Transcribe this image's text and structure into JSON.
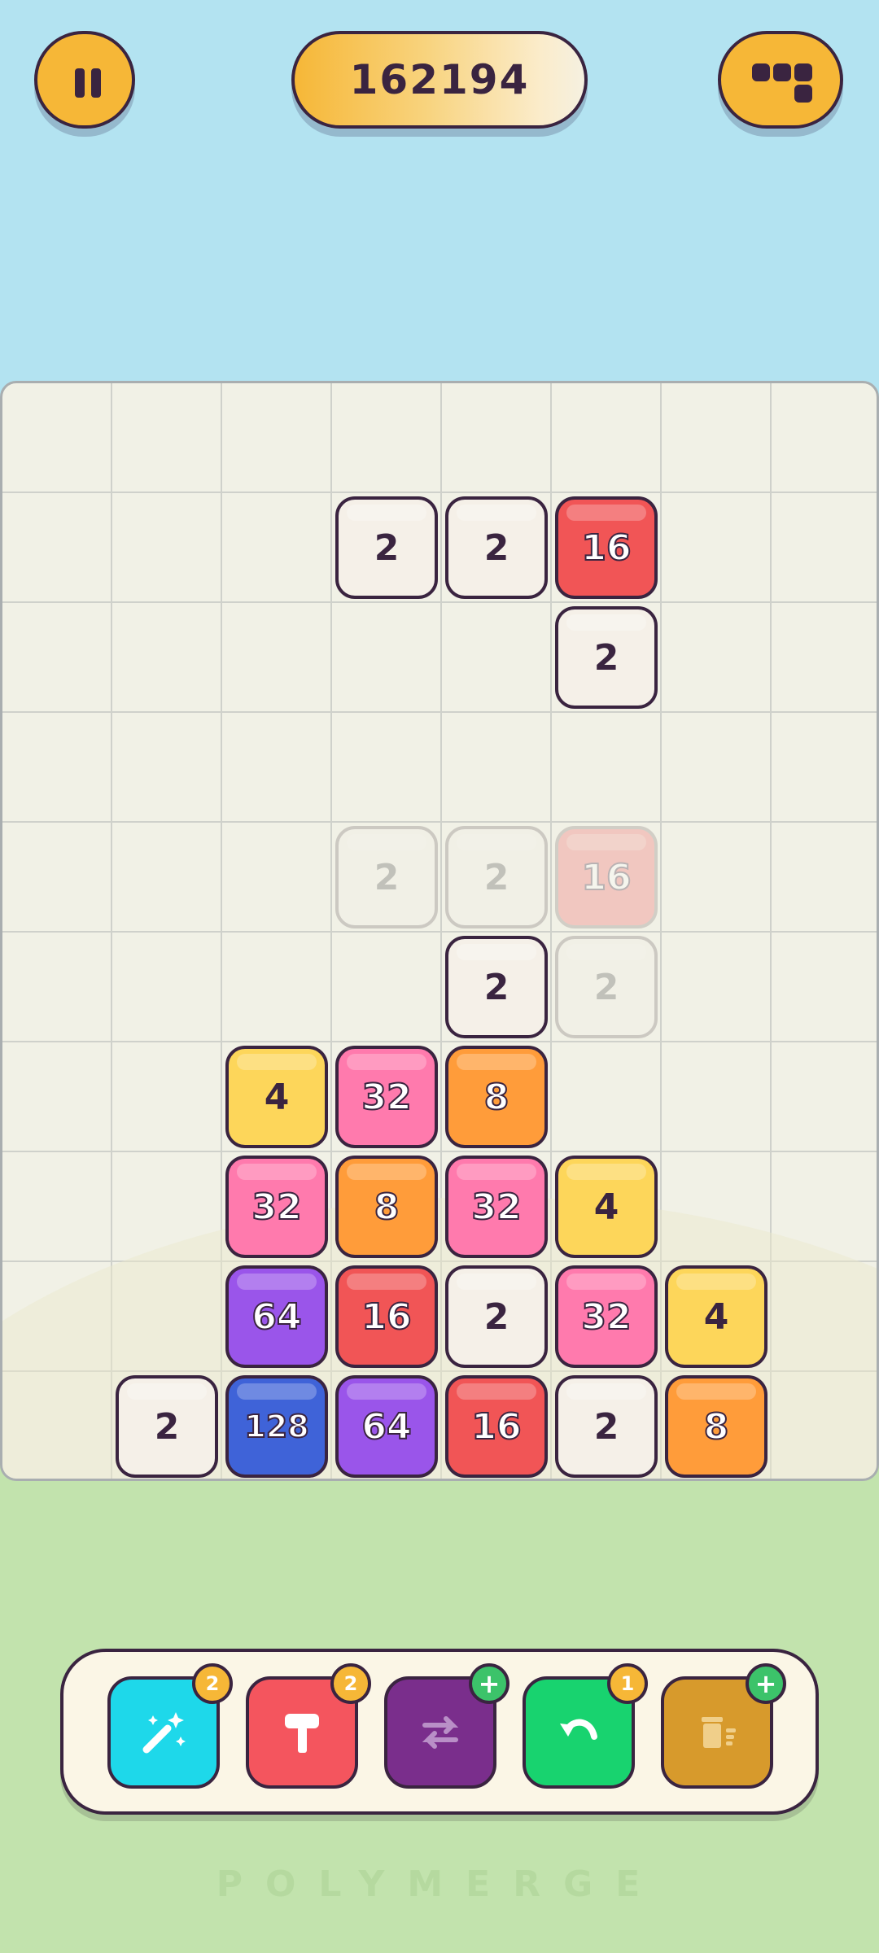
{
  "score": "162194",
  "board": {
    "columns": 8,
    "rows": 10,
    "tiles": [
      {
        "row": 1,
        "col": 3,
        "value": "2"
      },
      {
        "row": 1,
        "col": 4,
        "value": "2"
      },
      {
        "row": 1,
        "col": 5,
        "value": "16"
      },
      {
        "row": 2,
        "col": 5,
        "value": "2"
      },
      {
        "row": 5,
        "col": 4,
        "value": "2"
      },
      {
        "row": 6,
        "col": 2,
        "value": "4"
      },
      {
        "row": 6,
        "col": 3,
        "value": "32"
      },
      {
        "row": 6,
        "col": 4,
        "value": "8"
      },
      {
        "row": 7,
        "col": 2,
        "value": "32"
      },
      {
        "row": 7,
        "col": 3,
        "value": "8"
      },
      {
        "row": 7,
        "col": 4,
        "value": "32"
      },
      {
        "row": 7,
        "col": 5,
        "value": "4"
      },
      {
        "row": 8,
        "col": 2,
        "value": "64"
      },
      {
        "row": 8,
        "col": 3,
        "value": "16"
      },
      {
        "row": 8,
        "col": 4,
        "value": "2"
      },
      {
        "row": 8,
        "col": 5,
        "value": "32"
      },
      {
        "row": 8,
        "col": 6,
        "value": "4"
      },
      {
        "row": 9,
        "col": 1,
        "value": "2"
      },
      {
        "row": 9,
        "col": 2,
        "value": "128"
      },
      {
        "row": 9,
        "col": 3,
        "value": "64"
      },
      {
        "row": 9,
        "col": 4,
        "value": "16"
      },
      {
        "row": 9,
        "col": 5,
        "value": "2"
      },
      {
        "row": 9,
        "col": 6,
        "value": "8"
      }
    ],
    "ghost_tiles": [
      {
        "row": 4,
        "col": 3,
        "value": "2"
      },
      {
        "row": 4,
        "col": 4,
        "value": "2"
      },
      {
        "row": 4,
        "col": 5,
        "value": "16"
      },
      {
        "row": 5,
        "col": 5,
        "value": "2"
      }
    ]
  },
  "powerups": [
    {
      "name": "magic-wand",
      "icon": "magic-wand-icon",
      "badge": "2",
      "badge_type": "count",
      "color": "#1ed8ea"
    },
    {
      "name": "hammer",
      "icon": "hammer-icon",
      "badge": "2",
      "badge_type": "count",
      "color": "#f4555e"
    },
    {
      "name": "swap",
      "icon": "swap-arrows-icon",
      "badge": "+",
      "badge_type": "plus",
      "color": "#7a2e8c"
    },
    {
      "name": "undo",
      "icon": "undo-icon",
      "badge": "1",
      "badge_type": "count",
      "color": "#18d36f"
    },
    {
      "name": "trash",
      "icon": "trash-icon",
      "badge": "+",
      "badge_type": "plus",
      "color": "#d79a2c"
    }
  ],
  "footer_text": "POLYMERGE"
}
